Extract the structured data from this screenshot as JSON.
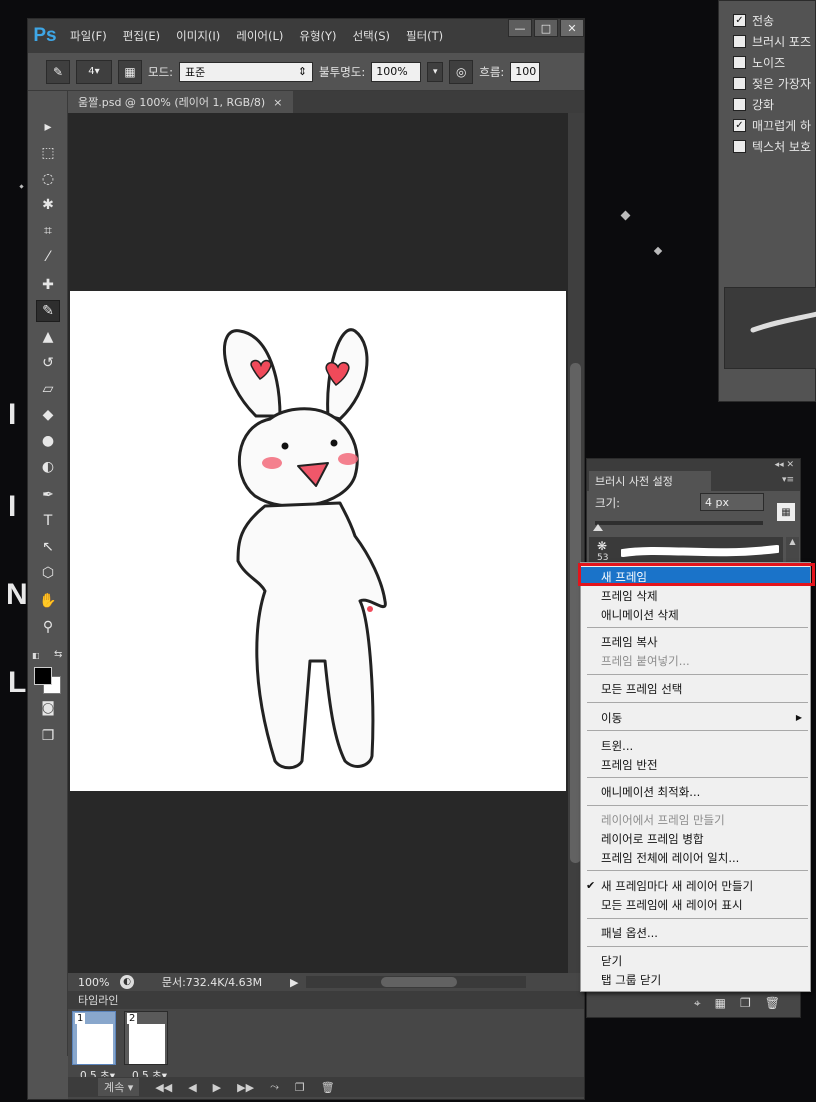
{
  "app": {
    "logo": "Ps"
  },
  "menubar": {
    "items": [
      "파일(F)",
      "편집(E)",
      "이미지(I)",
      "레이어(L)",
      "유형(Y)",
      "선택(S)",
      "필터(T)"
    ]
  },
  "window_controls": {
    "minimize": "—",
    "maximize": "□",
    "close": "✕"
  },
  "options_bar": {
    "brush_size": "4",
    "mode_label": "모드:",
    "mode_value": "표준",
    "opacity_label": "불투명도:",
    "opacity_value": "100%",
    "flow_label": "흐름:",
    "flow_value": "100"
  },
  "document": {
    "tab_title": "움짤.psd @ 100% (레이어 1, RGB/8)",
    "tab_close": "×"
  },
  "status_bar": {
    "zoom": "100%",
    "doc_info": "문서:732.4K/4.63M"
  },
  "timeline": {
    "title": "타임라인",
    "frames": [
      {
        "number": "1",
        "delay": "0.5 초▾"
      },
      {
        "number": "2",
        "delay": "0.5 초▾"
      }
    ],
    "loop_label": "계속"
  },
  "brush_options_panel": {
    "items": [
      {
        "label": "전송",
        "checked": true
      },
      {
        "label": "브러시 포즈",
        "checked": false
      },
      {
        "label": "노이즈",
        "checked": false
      },
      {
        "label": "젖은 가장자",
        "checked": false
      },
      {
        "label": "강화",
        "checked": false
      },
      {
        "label": "매끄럽게 하",
        "checked": true
      },
      {
        "label": "텍스처 보호",
        "checked": false
      }
    ]
  },
  "brush_preset_panel": {
    "tab_title": "브러시 사전 설정",
    "size_label": "크기:",
    "size_value": "4 px",
    "brush_number": "53"
  },
  "context_menu": {
    "items": [
      {
        "label": "새 프레임",
        "state": "highlight"
      },
      {
        "label": "프레임 삭제",
        "state": "normal"
      },
      {
        "label": "애니메이션 삭제",
        "state": "normal"
      },
      {
        "label": "프레임 복사",
        "state": "normal"
      },
      {
        "label": "프레임 붙여넣기...",
        "state": "disabled"
      },
      {
        "label": "모든 프레임 선택",
        "state": "normal"
      },
      {
        "label": "이동",
        "state": "normal"
      },
      {
        "label": "트윈...",
        "state": "normal"
      },
      {
        "label": "프레임 반전",
        "state": "normal"
      },
      {
        "label": "애니메이션 최적화...",
        "state": "normal"
      },
      {
        "label": "레이어에서 프레임 만들기",
        "state": "disabled"
      },
      {
        "label": "레이어로 프레임 병합",
        "state": "normal"
      },
      {
        "label": "프레임 전체에 레이어 일치...",
        "state": "normal"
      },
      {
        "label": "새 프레임마다 새 레이어 만들기",
        "state": "checked"
      },
      {
        "label": "모든 프레임에 새 레이어 표시",
        "state": "normal"
      },
      {
        "label": "패널 옵션...",
        "state": "normal"
      },
      {
        "label": "닫기",
        "state": "normal"
      },
      {
        "label": "탭 그룹 닫기",
        "state": "normal"
      }
    ]
  },
  "colors": {
    "highlight_outline": "#e3141c",
    "menu_highlight": "#1a73c9",
    "ps_logo": "#3ea6e6"
  }
}
